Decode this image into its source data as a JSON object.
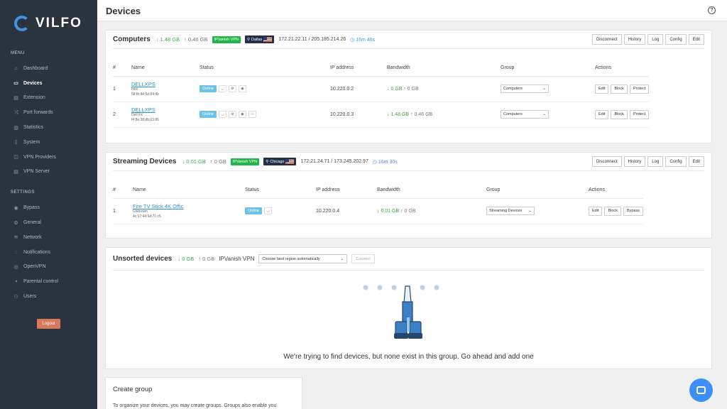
{
  "brand": {
    "name": "VILFO"
  },
  "sidebar": {
    "menu_heading": "MENU",
    "menu": [
      {
        "label": "Dashboard",
        "icon": "⌂"
      },
      {
        "label": "Devices",
        "icon": "▭"
      },
      {
        "label": "Extension",
        "icon": "▤"
      },
      {
        "label": "Port forwards",
        "icon": "⤨"
      },
      {
        "label": "Statistics",
        "icon": "▥"
      },
      {
        "label": "System",
        "icon": "▯"
      },
      {
        "label": "VPN Providers",
        "icon": "◫"
      },
      {
        "label": "VPN Server",
        "icon": "▤"
      }
    ],
    "settings_heading": "SETTINGS",
    "settings": [
      {
        "label": "Bypass",
        "icon": "◉"
      },
      {
        "label": "General",
        "icon": "⚙"
      },
      {
        "label": "Network",
        "icon": "≋"
      },
      {
        "label": "Notifications",
        "icon": "◌"
      },
      {
        "label": "OpenVPN",
        "icon": "◎"
      },
      {
        "label": "Parental control",
        "icon": "◑"
      },
      {
        "label": "Users",
        "icon": "⚇"
      }
    ],
    "logout_label": "Logout"
  },
  "header": {
    "title": "Devices",
    "help": "?"
  },
  "computers": {
    "title": "Computers",
    "down": "↓ 1.48 GB",
    "up": "↑ 0.46 GB",
    "vpn": "IPVanish VPN",
    "location": "Dallas",
    "ip": "172.21.22.11 / 205.185.214.26",
    "uptime": "◷ 16m 46s",
    "actions": [
      "Disconnect",
      "History",
      "Log",
      "Config",
      "Edit"
    ],
    "columns": [
      "#",
      "Name",
      "Status",
      "IP address",
      "Bandwidth",
      "Group",
      "Actions"
    ],
    "rows": [
      {
        "num": "1",
        "name": "DELLXPS",
        "vendor": "Intel",
        "mac": "58:fb:84:5d:84:4b",
        "status": "Online",
        "ip": "10.220.0.2",
        "down": "↓ 0 GB",
        "up": "↑ 0 GB",
        "group": "Computers"
      },
      {
        "num": "2",
        "name": "DELLXPS",
        "vendor": "Dell inc",
        "mac": "f4:8e:38:db:03:86",
        "status": "Online",
        "ip": "10.220.0.3",
        "down": "↓ 1.48 GB",
        "up": "↑ 0.46 GB",
        "group": "Computers"
      }
    ],
    "row_actions": [
      "Edit",
      "Block",
      "Protect"
    ]
  },
  "streaming": {
    "title": "Streaming Devices",
    "down": "↓ 0.01 GB",
    "up": "↑ 0 GB",
    "vpn": "IPVanish VPN",
    "location": "Chicago",
    "ip": "172.21.24.71 / 173.245.202.97",
    "uptime": "◷ 16m 30s",
    "actions": [
      "Disconnect",
      "History",
      "Log",
      "Config",
      "Edit"
    ],
    "columns": [
      "#",
      "Name",
      "Status",
      "IP address",
      "Bandwidth",
      "Group",
      "Actions"
    ],
    "rows": [
      {
        "num": "1",
        "name": "Fire TV Stick 4K Offic",
        "vendor": "Unknown",
        "mac": "4c:17:44:6d:71:c5",
        "status": "Online",
        "ip": "10.220.0.4",
        "down": "↓ 0.01 GB",
        "up": "↑ 0 GB",
        "group": "Streaming Devices"
      }
    ],
    "row_actions": [
      "Edit",
      "Block",
      "Bypass"
    ]
  },
  "unsorted": {
    "title": "Unsorted devices",
    "down": "↓ 0 GB",
    "up": "↑ 0 GB",
    "vpn_label": "IPVanish VPN",
    "region_placeholder": "Choose best region automatically",
    "connect_label": "Connect",
    "empty_message": "We're trying to find devices, but none exist in this group. Go ahead and add one"
  },
  "create_group": {
    "title": "Create group",
    "text": "To organize your devices, you may create groups. Groups also enable you"
  },
  "colors": {
    "sidebar": "#2a3441",
    "accent": "#4a90e2",
    "online": "#6cc3e6",
    "vpn_green": "#21b54a",
    "logout": "#d9775b"
  }
}
